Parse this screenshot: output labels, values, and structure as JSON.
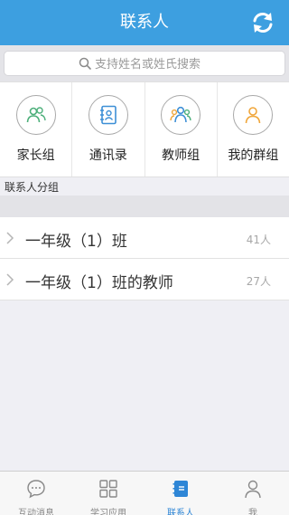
{
  "header": {
    "title": "联系人",
    "refresh_icon": "refresh-icon"
  },
  "search": {
    "placeholder": "支持姓名或姓氏搜索",
    "icon": "search-icon"
  },
  "groups": [
    {
      "label": "家长组",
      "icon": "parents-icon"
    },
    {
      "label": "通讯录",
      "icon": "address-book-icon"
    },
    {
      "label": "教师组",
      "icon": "teachers-icon"
    },
    {
      "label": "我的群组",
      "icon": "my-group-icon"
    }
  ],
  "section": {
    "label": "联系人分组"
  },
  "contact_groups": [
    {
      "name": "一年级（1）班",
      "count": "41人"
    },
    {
      "name": "一年级（1）班的教师",
      "count": "27人"
    }
  ],
  "tabs": [
    {
      "label": "互动消息",
      "icon": "chat-icon",
      "active": false
    },
    {
      "label": "学习应用",
      "icon": "apps-grid-icon",
      "active": false
    },
    {
      "label": "联系人",
      "icon": "contacts-icon",
      "active": true
    },
    {
      "label": "我",
      "icon": "person-icon",
      "active": false
    }
  ],
  "colors": {
    "accent": "#3d9fe0",
    "active_tab": "#2e86d6",
    "icon_green": "#4caf7a",
    "icon_blue": "#3d8fd6",
    "icon_orange": "#f0a63a"
  }
}
